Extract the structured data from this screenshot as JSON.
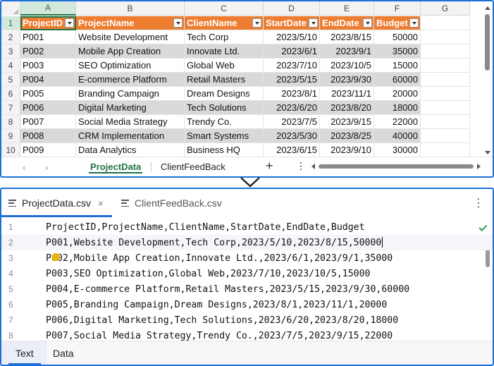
{
  "spreadsheet": {
    "column_letters": [
      "A",
      "B",
      "C",
      "D",
      "E",
      "F",
      "G"
    ],
    "selected_column": "A",
    "row_numbers": [
      "1",
      "2",
      "3",
      "4",
      "5",
      "6",
      "7",
      "8",
      "9",
      "10"
    ],
    "header_row": [
      "ProjectID",
      "ProjectName",
      "ClientName",
      "StartDate",
      "EndDate",
      "Budget"
    ],
    "rows": [
      [
        "P001",
        "Website Development",
        "Tech Corp",
        "2023/5/10",
        "2023/8/15",
        "50000"
      ],
      [
        "P002",
        "Mobile App Creation",
        "Innovate Ltd.",
        "2023/6/1",
        "2023/9/1",
        "35000"
      ],
      [
        "P003",
        "SEO Optimization",
        "Global Web",
        "2023/7/10",
        "2023/10/5",
        "15000"
      ],
      [
        "P004",
        "E-commerce Platform",
        "Retail Masters",
        "2023/5/15",
        "2023/9/30",
        "60000"
      ],
      [
        "P005",
        "Branding Campaign",
        "Dream Designs",
        "2023/8/1",
        "2023/11/1",
        "20000"
      ],
      [
        "P006",
        "Digital Marketing",
        "Tech Solutions",
        "2023/6/20",
        "2023/8/20",
        "18000"
      ],
      [
        "P007",
        "Social Media Strategy",
        "Trendy Co.",
        "2023/7/5",
        "2023/9/15",
        "22000"
      ],
      [
        "P008",
        "CRM Implementation",
        "Smart Systems",
        "2023/5/30",
        "2023/8/25",
        "40000"
      ],
      [
        "P009",
        "Data Analytics",
        "Business HQ",
        "2023/6/15",
        "2023/9/10",
        "30000"
      ]
    ],
    "sheet_tabs": [
      "ProjectData",
      "ClientFeedBack"
    ],
    "active_sheet": "ProjectData",
    "colors": {
      "header_fill": "#ed7d31",
      "band_fill": "#d9d9d9",
      "accent": "#217346"
    }
  },
  "editor": {
    "file_tabs": [
      {
        "label": "ProjectData.csv",
        "active": true
      },
      {
        "label": "ClientFeedBack.csv",
        "active": false
      }
    ],
    "close_glyph": "×",
    "more_glyph": "⋮",
    "lines": [
      {
        "n": "1",
        "text": "ProjectID,ProjectName,ClientName,StartDate,EndDate,Budget"
      },
      {
        "n": "2",
        "text": "P001,Website Development,Tech Corp,2023/5/10,2023/8/15,50000"
      },
      {
        "n": "3",
        "text": "P002,Mobile App Creation,Innovate Ltd.,2023/6/1,2023/9/1,35000"
      },
      {
        "n": "4",
        "text": "P003,SEO Optimization,Global Web,2023/7/10,2023/10/5,15000"
      },
      {
        "n": "5",
        "text": "P004,E-commerce Platform,Retail Masters,2023/5/15,2023/9/30,60000"
      },
      {
        "n": "6",
        "text": "P005,Branding Campaign,Dream Designs,2023/8/1,2023/11/1,20000"
      },
      {
        "n": "7",
        "text": "P006,Digital Marketing,Tech Solutions,2023/6/20,2023/8/20,18000"
      },
      {
        "n": "8",
        "text": "P007,Social Media Strategy,Trendy Co.,2023/7/5,2023/9/15,22000"
      }
    ],
    "current_line": "2",
    "bottom_tabs": [
      "Text",
      "Data"
    ],
    "active_bottom_tab": "Text",
    "colors": {
      "accent": "#1e6fd9",
      "check": "#2e9e4f"
    }
  },
  "sheet_nav": {
    "prev": "‹",
    "next": "›",
    "add": "+",
    "more": "⋮"
  }
}
